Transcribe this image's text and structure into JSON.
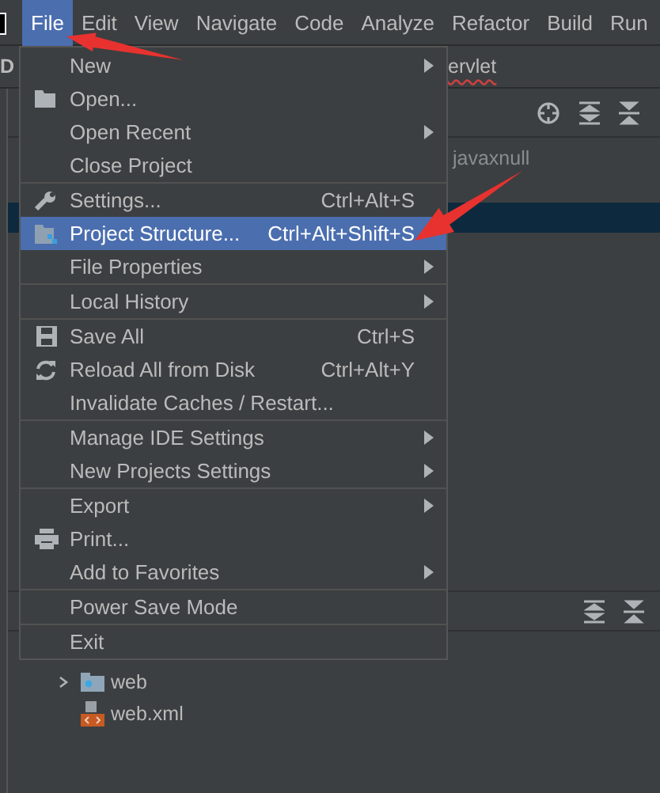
{
  "menubar": [
    {
      "label": "File",
      "selected": true
    },
    {
      "label": "Edit",
      "selected": false
    },
    {
      "label": "View",
      "selected": false
    },
    {
      "label": "Navigate",
      "selected": false
    },
    {
      "label": "Code",
      "selected": false
    },
    {
      "label": "Analyze",
      "selected": false
    },
    {
      "label": "Refactor",
      "selected": false
    },
    {
      "label": "Build",
      "selected": false
    },
    {
      "label": "Run",
      "selected": false
    }
  ],
  "tabs": [
    {
      "label": "D"
    },
    {
      "label": "ervlet"
    }
  ],
  "structure_panel": {
    "text": "javaxnull"
  },
  "file_menu": [
    {
      "kind": "item",
      "label": "New",
      "submenu": true,
      "selected": false
    },
    {
      "kind": "item",
      "label": "Open...",
      "submenu": false,
      "selected": false
    },
    {
      "kind": "item",
      "label": "Open Recent",
      "submenu": true,
      "selected": false
    },
    {
      "kind": "item",
      "label": "Close Project",
      "submenu": false,
      "selected": false
    },
    {
      "kind": "separator"
    },
    {
      "kind": "item",
      "label": "Settings...",
      "shortcut": "Ctrl+Alt+S",
      "submenu": false,
      "selected": false
    },
    {
      "kind": "item",
      "label": "Project Structure...",
      "shortcut": "Ctrl+Alt+Shift+S",
      "submenu": false,
      "selected": true
    },
    {
      "kind": "item",
      "label": "File Properties",
      "submenu": true,
      "selected": false
    },
    {
      "kind": "separator"
    },
    {
      "kind": "item",
      "label": "Local History",
      "submenu": true,
      "selected": false
    },
    {
      "kind": "separator"
    },
    {
      "kind": "item",
      "label": "Save All",
      "shortcut": "Ctrl+S",
      "submenu": false,
      "selected": false
    },
    {
      "kind": "item",
      "label": "Reload All from Disk",
      "shortcut": "Ctrl+Alt+Y",
      "submenu": false,
      "selected": false
    },
    {
      "kind": "item",
      "label": "Invalidate Caches / Restart...",
      "submenu": false,
      "selected": false
    },
    {
      "kind": "separator"
    },
    {
      "kind": "item",
      "label": "Manage IDE Settings",
      "submenu": true,
      "selected": false
    },
    {
      "kind": "item",
      "label": "New Projects Settings",
      "submenu": true,
      "selected": false
    },
    {
      "kind": "separator"
    },
    {
      "kind": "item",
      "label": "Export",
      "submenu": true,
      "selected": false
    },
    {
      "kind": "item",
      "label": "Print...",
      "submenu": false,
      "selected": false
    },
    {
      "kind": "item",
      "label": "Add to Favorites",
      "submenu": true,
      "selected": false
    },
    {
      "kind": "separator"
    },
    {
      "kind": "item",
      "label": "Power Save Mode",
      "submenu": false,
      "selected": false
    },
    {
      "kind": "separator"
    },
    {
      "kind": "item",
      "label": "Exit",
      "submenu": false,
      "selected": false
    }
  ],
  "project_tree": [
    {
      "kind": "folder",
      "label": "web",
      "expanded": false
    },
    {
      "kind": "file",
      "label": "web.xml"
    }
  ]
}
